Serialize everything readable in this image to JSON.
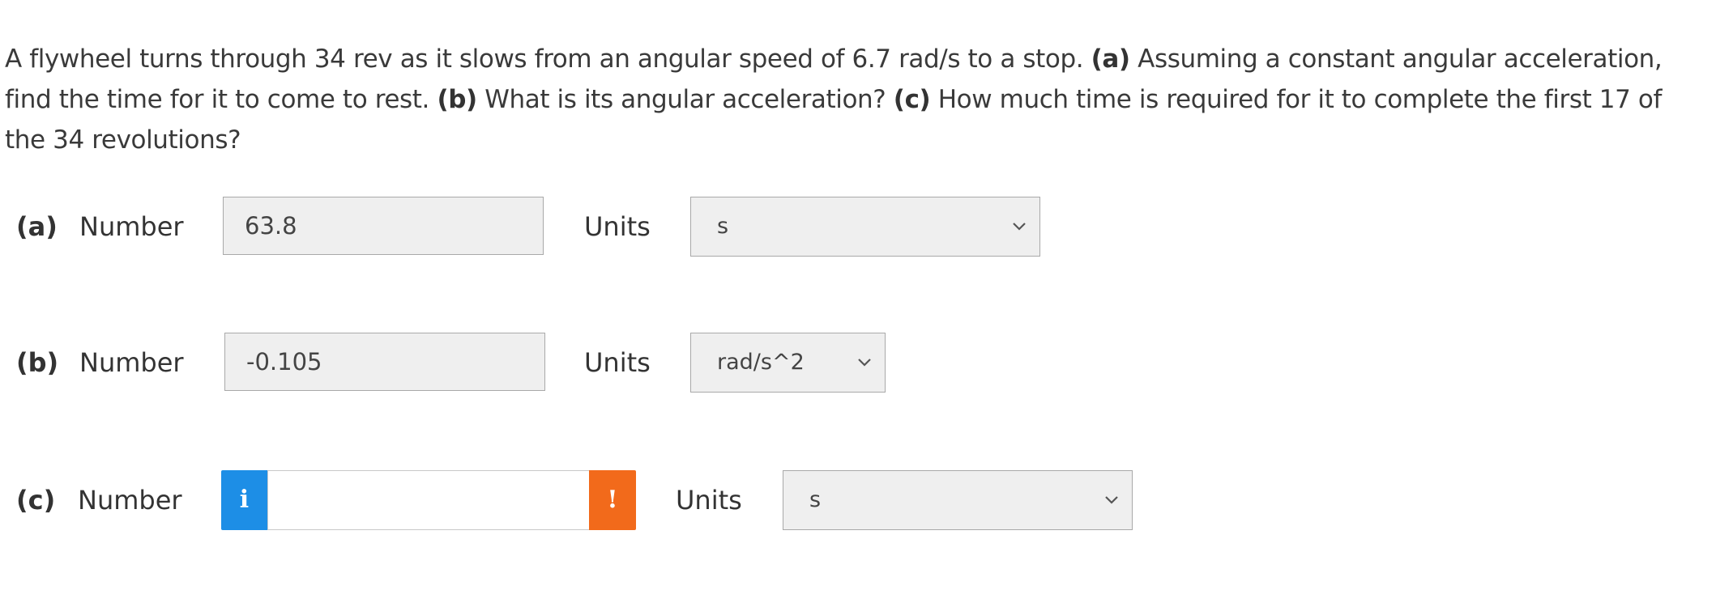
{
  "question": {
    "intro": "A flywheel turns through 34 rev as it slows from an angular speed of 6.7 rad/s to a stop. ",
    "a_tag": "(a)",
    "a_text": " Assuming a constant angular acceleration, find the time for it to come to rest. ",
    "b_tag": "(b)",
    "b_text": " What is its angular acceleration? ",
    "c_tag": "(c)",
    "c_text": " How much time is required for it to complete the first 17 of the 34 revolutions?"
  },
  "parts": [
    {
      "label": "(a)",
      "number_label": "Number",
      "value": "63.8",
      "units_label": "Units",
      "unit": "s"
    },
    {
      "label": "(b)",
      "number_label": "Number",
      "value": "-0.105",
      "units_label": "Units",
      "unit": "rad/s^2"
    },
    {
      "label": "(c)",
      "number_label": "Number",
      "value": "",
      "units_label": "Units",
      "unit": "s",
      "info_glyph": "i",
      "warning_glyph": "!"
    }
  ],
  "colors": {
    "info": "#1d8ee6",
    "warning": "#f26a1b",
    "field_bg": "#efefef"
  },
  "icons": {
    "dropdown": "chevron-down-icon",
    "info": "info-icon",
    "warning": "warning-icon"
  }
}
